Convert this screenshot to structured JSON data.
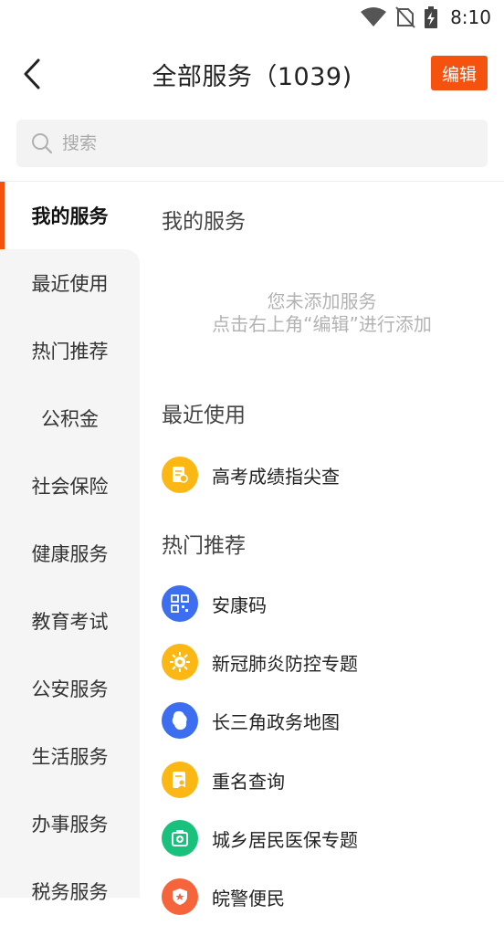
{
  "status_bar": {
    "time": "8:10"
  },
  "header": {
    "title": "全部服务（1039)",
    "edit_label": "编辑"
  },
  "search": {
    "placeholder": "搜索"
  },
  "sidebar": {
    "items": [
      {
        "label": "我的服务"
      },
      {
        "label": "最近使用"
      },
      {
        "label": "热门推荐"
      },
      {
        "label": "公积金"
      },
      {
        "label": "社会保险"
      },
      {
        "label": "健康服务"
      },
      {
        "label": "教育考试"
      },
      {
        "label": "公安服务"
      },
      {
        "label": "生活服务"
      },
      {
        "label": "办事服务"
      },
      {
        "label": "税务服务"
      }
    ]
  },
  "content": {
    "my_services": {
      "title": "我的服务",
      "empty_line1": "您未添加服务",
      "empty_line2": "点击右上角“编辑”进行添加"
    },
    "recent": {
      "title": "最近使用",
      "items": [
        {
          "label": "高考成绩指尖查",
          "icon": "score-report-icon",
          "color": "#fbb814"
        }
      ]
    },
    "hot": {
      "title": "热门推荐",
      "items": [
        {
          "label": "安康码",
          "icon": "qr-code-icon",
          "color": "#3d6ef0"
        },
        {
          "label": "新冠肺炎防控专题",
          "icon": "virus-icon",
          "color": "#fbb814"
        },
        {
          "label": "长三角政务地图",
          "icon": "map-icon",
          "color": "#3d6ef0"
        },
        {
          "label": "重名查询",
          "icon": "name-search-icon",
          "color": "#fbb814"
        },
        {
          "label": "城乡居民医保专题",
          "icon": "medical-kit-icon",
          "color": "#19c17c"
        },
        {
          "label": "皖警便民",
          "icon": "police-badge-icon",
          "color": "#f5643a"
        }
      ]
    }
  }
}
